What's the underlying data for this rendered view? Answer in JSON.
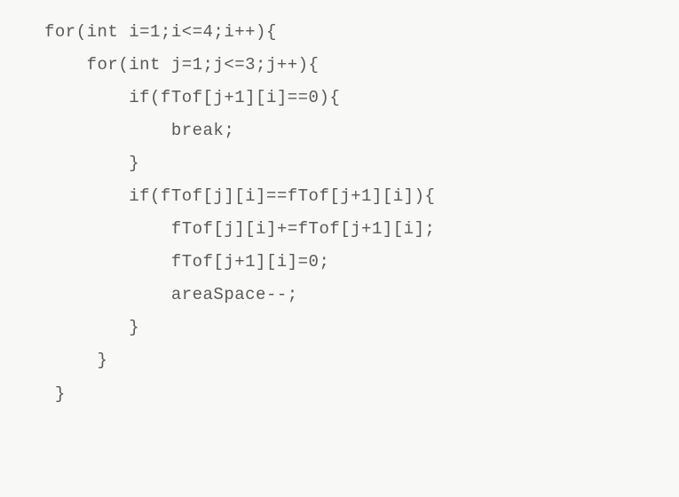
{
  "code": {
    "lines": [
      "for(int i=1;i<=4;i++){",
      "    for(int j=1;j<=3;j++){",
      "        if(fTof[j+1][i]==0){",
      "            break;",
      "        }",
      "        if(fTof[j][i]==fTof[j+1][i]){",
      "            fTof[j][i]+=fTof[j+1][i];",
      "            fTof[j+1][i]=0;",
      "            areaSpace--;",
      "        }",
      "     }",
      " }"
    ]
  }
}
